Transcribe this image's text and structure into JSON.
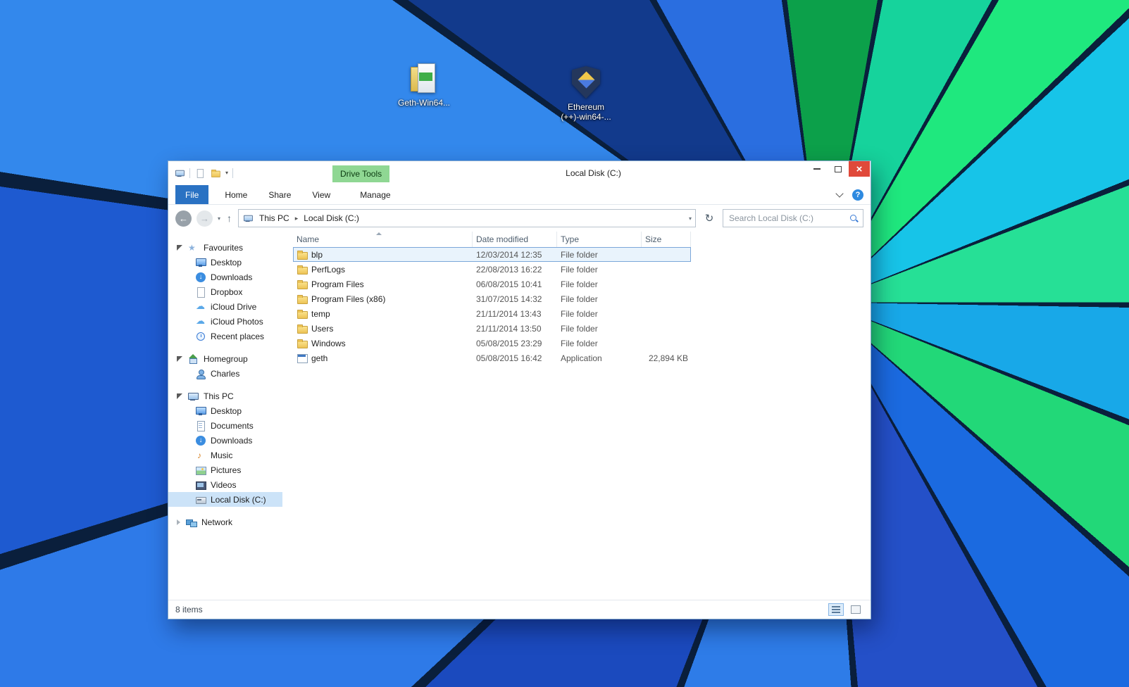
{
  "desktop_icons": {
    "geth": {
      "label": "Geth-Win64..."
    },
    "ethereum": {
      "label_line1": "Ethereum",
      "label_line2": "(++)-win64-..."
    }
  },
  "explorer": {
    "titlebar": {
      "title": "Local Disk (C:)",
      "contextual_tab": "Drive Tools"
    },
    "ribbon": {
      "tabs": [
        {
          "label": "File"
        },
        {
          "label": "Home"
        },
        {
          "label": "Share"
        },
        {
          "label": "View"
        },
        {
          "label": "Manage"
        }
      ]
    },
    "addressbar": {
      "breadcrumb_root": "This PC",
      "breadcrumb_current": "Local Disk (C:)",
      "search_placeholder": "Search Local Disk (C:)"
    },
    "sidebar": {
      "groups": [
        {
          "label": "Favourites",
          "items": [
            {
              "label": "Desktop",
              "icon": "monitor-icon"
            },
            {
              "label": "Downloads",
              "icon": "download-icon"
            },
            {
              "label": "Dropbox",
              "icon": "document-icon"
            },
            {
              "label": "iCloud Drive",
              "icon": "cloud-icon"
            },
            {
              "label": "iCloud Photos",
              "icon": "cloud-icon"
            },
            {
              "label": "Recent places",
              "icon": "clock-icon"
            }
          ]
        },
        {
          "label": "Homegroup",
          "items": [
            {
              "label": "Charles",
              "icon": "user-icon"
            }
          ]
        },
        {
          "label": "This PC",
          "items": [
            {
              "label": "Desktop",
              "icon": "monitor-icon"
            },
            {
              "label": "Documents",
              "icon": "document-icon"
            },
            {
              "label": "Downloads",
              "icon": "download-icon"
            },
            {
              "label": "Music",
              "icon": "music-icon"
            },
            {
              "label": "Pictures",
              "icon": "picture-icon"
            },
            {
              "label": "Videos",
              "icon": "video-icon"
            },
            {
              "label": "Local Disk (C:)",
              "icon": "disk-icon",
              "selected": true
            }
          ]
        },
        {
          "label": "Network",
          "items": []
        }
      ]
    },
    "list": {
      "columns": [
        "Name",
        "Date modified",
        "Type",
        "Size"
      ],
      "rows": [
        {
          "name": "blp",
          "date": "12/03/2014 12:35",
          "type": "File folder",
          "size": "",
          "selected": true
        },
        {
          "name": "PerfLogs",
          "date": "22/08/2013 16:22",
          "type": "File folder",
          "size": ""
        },
        {
          "name": "Program Files",
          "date": "06/08/2015 10:41",
          "type": "File folder",
          "size": ""
        },
        {
          "name": "Program Files (x86)",
          "date": "31/07/2015 14:32",
          "type": "File folder",
          "size": ""
        },
        {
          "name": "temp",
          "date": "21/11/2014 13:43",
          "type": "File folder",
          "size": ""
        },
        {
          "name": "Users",
          "date": "21/11/2014 13:50",
          "type": "File folder",
          "size": ""
        },
        {
          "name": "Windows",
          "date": "05/08/2015 23:29",
          "type": "File folder",
          "size": ""
        },
        {
          "name": "geth",
          "date": "05/08/2015 16:42",
          "type": "Application",
          "size": "22,894 KB"
        }
      ]
    },
    "statusbar": {
      "items_count": "8 items"
    },
    "colors": {
      "file_tab_blue": "#2a72c3",
      "drive_tools_green": "#8fd793",
      "close_button_red": "#e0493a",
      "selection_border_blue": "#7ba7d9",
      "sidebar_selection_blue": "#cce3f8"
    }
  }
}
